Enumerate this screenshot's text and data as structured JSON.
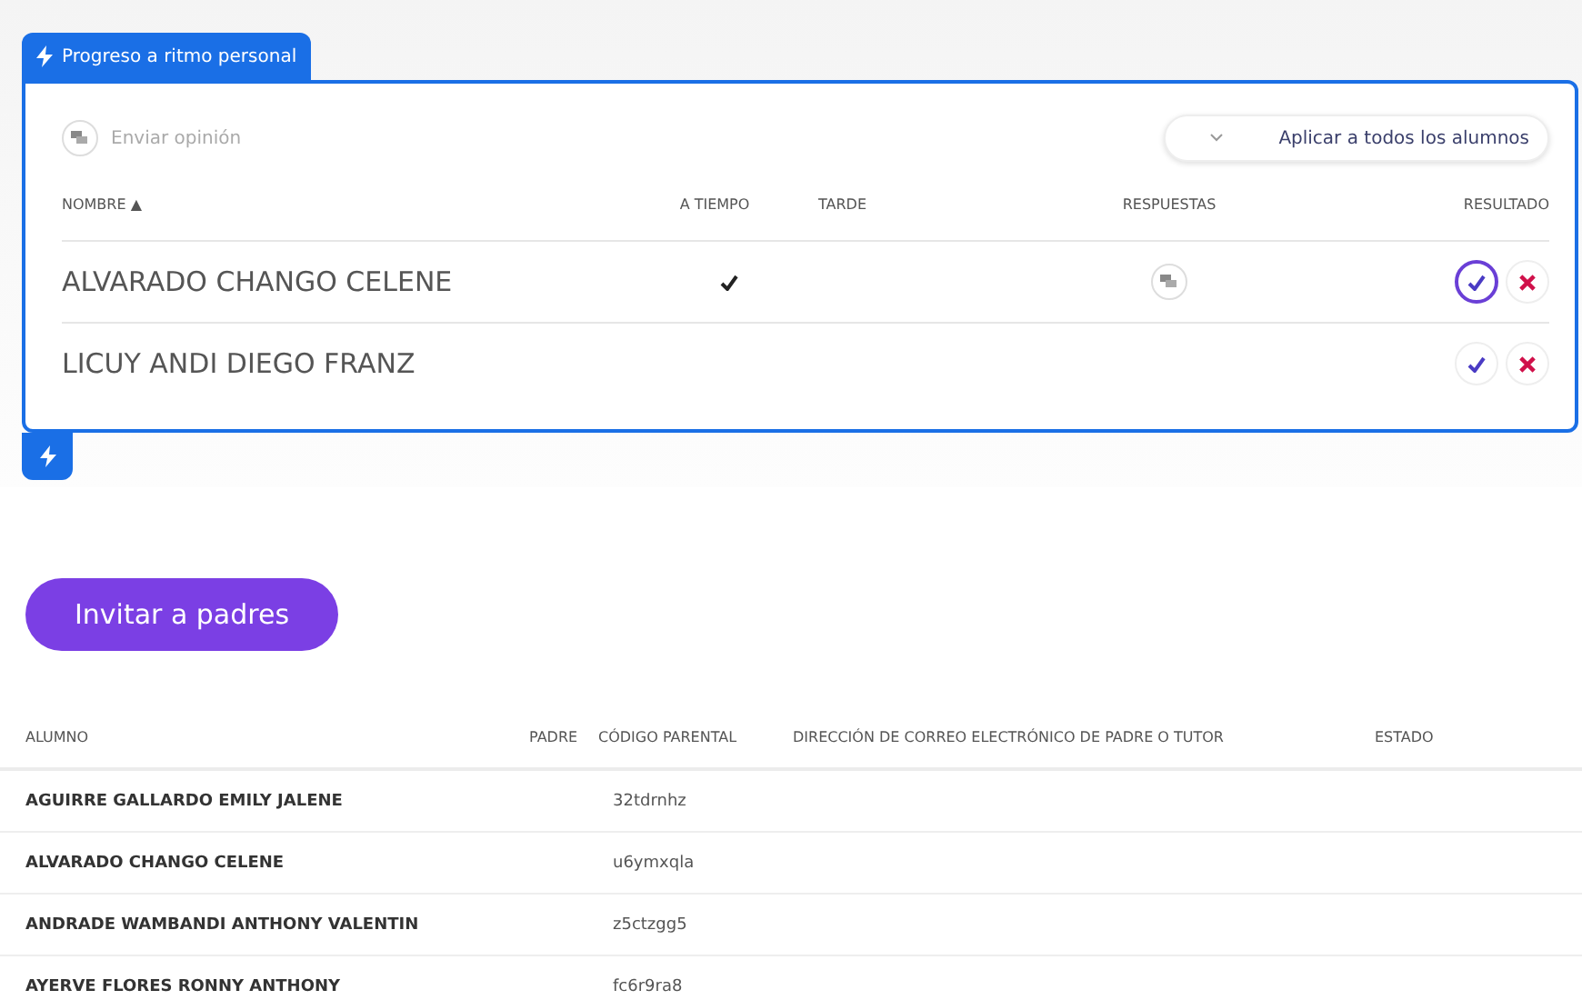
{
  "panel": {
    "tab_label": "Progreso a ritmo personal",
    "feedback_label": "Enviar opinión",
    "apply_all_label": "Aplicar a todos los alumnos",
    "columns": [
      "NOMBRE ▲",
      "A TIEMPO",
      "TARDE",
      "RESPUESTAS",
      "RESULTADO"
    ],
    "rows": [
      {
        "name": "ALVARADO CHANGO CELENE",
        "on_time": true,
        "has_response": true,
        "check_selected": true
      },
      {
        "name": "LICUY ANDI DIEGO FRANZ",
        "on_time": false,
        "has_response": false,
        "check_selected": false
      }
    ]
  },
  "invite_button": "Invitar a padres",
  "parents_table": {
    "columns": [
      "ALUMNO",
      "PADRE",
      "CÓDIGO PARENTAL",
      "DIRECCIÓN DE CORREO ELECTRÓNICO DE PADRE O TUTOR",
      "ESTADO"
    ],
    "rows": [
      {
        "student": "AGUIRRE GALLARDO EMILY JALENE",
        "code": "32tdrnhz"
      },
      {
        "student": "ALVARADO CHANGO CELENE",
        "code": "u6ymxqla"
      },
      {
        "student": "ANDRADE WAMBANDI ANTHONY VALENTIN",
        "code": "z5ctzgg5"
      },
      {
        "student": "AYERVE FLORES RONNY ANTHONY",
        "code": "fc6r9ra8"
      }
    ]
  }
}
